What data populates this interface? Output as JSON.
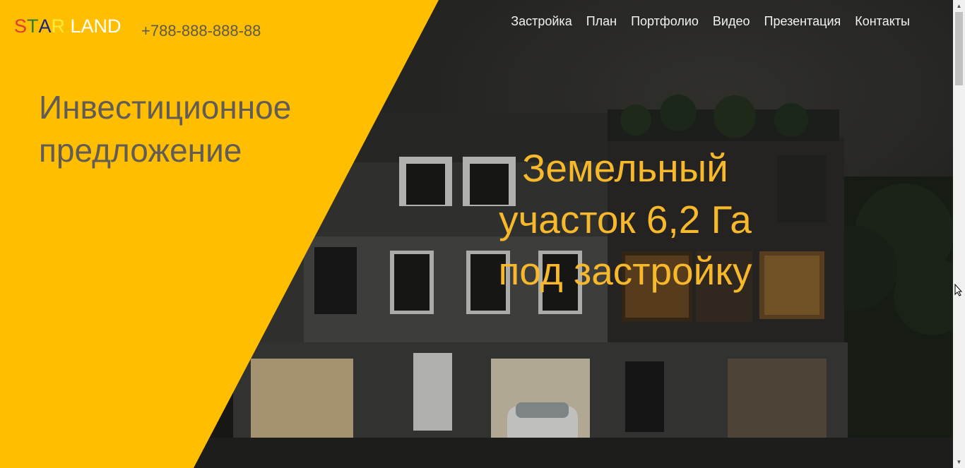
{
  "header": {
    "brand": {
      "letters": [
        {
          "char": "S",
          "color": "#e53935"
        },
        {
          "char": "T",
          "color": "#2e7d32"
        },
        {
          "char": "A",
          "color": "#1a237e"
        },
        {
          "char": "R",
          "color": "#ffeb3b"
        },
        {
          "char": " LAND",
          "color": "#ffffff"
        }
      ]
    },
    "phone": "+788-888-888-88"
  },
  "nav": {
    "items": [
      {
        "label": "Застройка"
      },
      {
        "label": "План"
      },
      {
        "label": "Портфолио"
      },
      {
        "label": "Видео"
      },
      {
        "label": "Презентация"
      },
      {
        "label": "Контакты"
      }
    ]
  },
  "hero": {
    "subtitle_line1": "Инвестиционное",
    "subtitle_line2": "предложение",
    "headline_line1": "Земельный",
    "headline_line2": "участок 6,2 Га",
    "headline_line3": "под застройку"
  },
  "colors": {
    "accent_yellow": "#ffbe00",
    "headline_gold": "#f7b92b",
    "subtitle_gray": "#615c55"
  },
  "icons": {
    "cursor": "resize-cursor-icon",
    "scroll_up": "scroll-up-arrow-icon",
    "scroll_down": "scroll-down-arrow-icon"
  }
}
